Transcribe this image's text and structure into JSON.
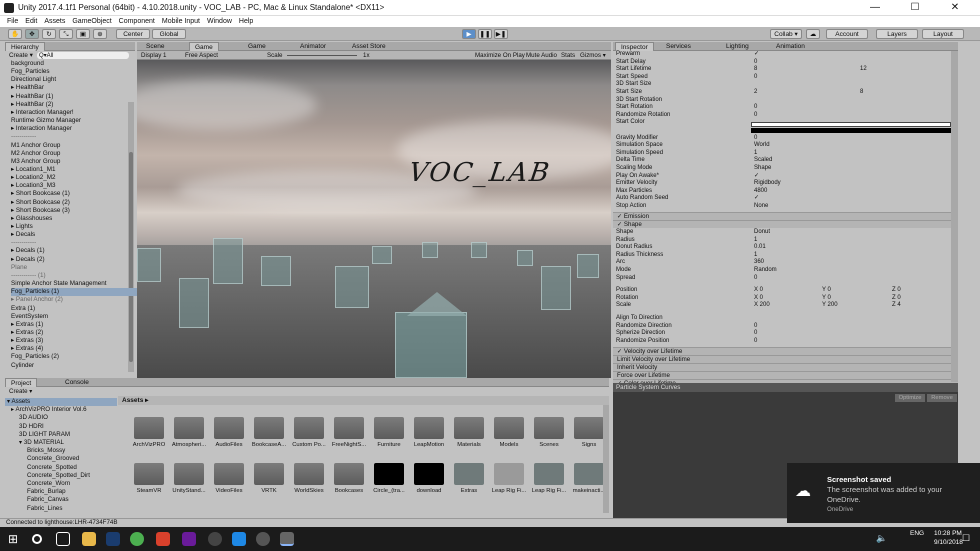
{
  "window": {
    "title": "Unity 2017.4.1f1 Personal (64bit) - 4.10.2018.unity - VOC_LAB - PC, Mac & Linux Standalone* <DX11>"
  },
  "menu": [
    "File",
    "Edit",
    "Assets",
    "GameObject",
    "Component",
    "Mobile Input",
    "Window",
    "Help"
  ],
  "toolbar": {
    "center": "Center",
    "global": "Global",
    "collab": "Collab ▾",
    "account": "Account",
    "layers": "Layers",
    "layout": "Layout"
  },
  "hierarchy": {
    "tab": "Hierarchy",
    "create": "Create ▾",
    "search": "Q▾All",
    "items": [
      "background",
      "Fog_Particles",
      "Directional Light",
      "▸ HealthBar",
      "▸ HealthBar (1)",
      "▸ HealthBar (2)",
      "▸ Interaction Manager!",
      "Runtime Gizmo Manager",
      "▸ Interaction Manager",
      "------------",
      "M1 Anchor Group",
      "M2 Anchor Group",
      "M3 Anchor Group",
      "▸ Location1_M1",
      "▸ Location2_M2",
      "▸ Location3_M3",
      "▸ Short Bookcase (1)",
      "▸ Short Bookcase (2)",
      "▸ Short Bookcase (3)",
      "▸ Glasshouses",
      "▸ Lights",
      "▸ Decals",
      "------------",
      "▸ Decals (1)",
      "▸ Decals (2)",
      "Plane",
      "------------ (1)",
      "Simple Anchor State Management",
      "Fog_Particles (1)",
      "▸ Panel Anchor (2)",
      "Extra (1)",
      "EventSystem",
      "▸ Extras (1)",
      "▸ Extras (2)",
      "▸ Extras (3)",
      "▸ Extras (4)",
      "Fog_Particles (2)",
      "Cylinder"
    ]
  },
  "viewtabs": {
    "scene": "Scene",
    "game": "Game",
    "game2": "Game",
    "animator": "Animator",
    "assetstore": "Asset Store"
  },
  "gamebar": {
    "display": "Display 1",
    "aspect": "Free Aspect",
    "scale": "Scale",
    "scaleval": "1x",
    "maximize": "Maximize On Play",
    "mute": "Mute Audio",
    "stats": "Stats",
    "gizmos": "Gizmos ▾"
  },
  "viewport": {
    "logo": "VOC_LAB"
  },
  "inspector": {
    "tabs": [
      "Inspector",
      "Services",
      "Lighting",
      "Animation"
    ],
    "rows": [
      [
        "Prewarm",
        "✓",
        ""
      ],
      [
        "Start Delay",
        "0",
        ""
      ],
      [
        "Start Lifetime",
        "8",
        "12"
      ],
      [
        "Start Speed",
        "0",
        ""
      ],
      [
        "3D Start Size",
        "",
        ""
      ],
      [
        "Start Size",
        "2",
        "8"
      ],
      [
        "3D Start Rotation",
        "",
        ""
      ],
      [
        "Start Rotation",
        "0",
        ""
      ],
      [
        "Randomize Rotation",
        "0",
        ""
      ],
      [
        "Start Color",
        "",
        ""
      ],
      [
        "",
        "",
        ""
      ],
      [
        "Gravity Modifier",
        "0",
        ""
      ],
      [
        "Simulation Space",
        "World",
        ""
      ],
      [
        "Simulation Speed",
        "1",
        ""
      ],
      [
        "Delta Time",
        "Scaled",
        ""
      ],
      [
        "Scaling Mode",
        "Shape",
        ""
      ],
      [
        "Play On Awake*",
        "✓",
        ""
      ],
      [
        "Emitter Velocity",
        "Rigidbody",
        ""
      ],
      [
        "Max Particles",
        "4800",
        ""
      ],
      [
        "Auto Random Seed",
        "✓",
        ""
      ],
      [
        "Stop Action",
        "None",
        ""
      ]
    ],
    "sections": {
      "emission": "✓ Emission",
      "shape": "✓ Shape"
    },
    "shape_rows": [
      [
        "Shape",
        "Donut"
      ],
      [
        "Radius",
        "1"
      ],
      [
        "Donut Radius",
        "0.01"
      ],
      [
        "Radius Thickness",
        "1"
      ],
      [
        "Arc",
        "360"
      ],
      [
        "  Mode",
        "Random"
      ],
      [
        "  Spread",
        "0"
      ]
    ],
    "transform": [
      [
        "Position",
        "X 0",
        "Y 0",
        "Z 0"
      ],
      [
        "Rotation",
        "X 0",
        "Y 0",
        "Z 0"
      ],
      [
        "Scale",
        "X 200",
        "Y 200",
        "Z 4"
      ]
    ],
    "more_rows": [
      [
        "Align To Direction",
        ""
      ],
      [
        "Randomize Direction",
        "0"
      ],
      [
        "Spherize Direction",
        "0"
      ],
      [
        "Randomize Position",
        "0"
      ]
    ],
    "modules": [
      "✓ Velocity over Lifetime",
      "  Limit Velocity over Lifetime",
      "  Inherit Velocity",
      "  Force over Lifetime",
      "✓ Color over Lifetime"
    ],
    "curves": "Particle System Curves",
    "optimize": "Optimize",
    "remove": "Remove"
  },
  "project": {
    "tabs": [
      "Project",
      "Console"
    ],
    "create": "Create ▾",
    "tree": [
      "▾ Assets",
      "▸ ArchVizPRO Interior Vol.6",
      "3D AUDIO",
      "3D HDRI",
      "3D LIGHT PARAM",
      "▾ 3D MATERIAL",
      "Bricks_Mossy",
      "Concrete_Grooved",
      "Concrete_Spotted",
      "Concrete_Spotted_Dirt",
      "Concrete_Worn",
      "Fabric_Burlap",
      "Fabric_Canvas",
      "Fabric_Lines"
    ],
    "breadcrumb": "Assets ▸",
    "row1": [
      "ArchVizPRO",
      "Atmospheri...",
      "AudioFiles",
      "BookcaseA...",
      "Custom Po...",
      "FreeNightS...",
      "Furniture",
      "LeapMotion",
      "Materials",
      "Models",
      "Scenes",
      "Signs"
    ],
    "row2": [
      "SteamVR",
      "UnityStand...",
      "VideoFiles",
      "VRTK",
      "WorldSkies",
      "Bookcases",
      "Circle_(tra...",
      "download",
      "Extras",
      "Leap Rig Fi...",
      "Leap Rig Fi...",
      "makeinacti..."
    ]
  },
  "status": "Connected to lighthouse:LHR-4734F74B",
  "toast": {
    "title": "Screenshot saved",
    "body": "The screenshot was added to your OneDrive.",
    "app": "OneDrive"
  },
  "clock": {
    "time": "10:28 PM",
    "date": "9/10/2018",
    "lang": "ENG"
  }
}
